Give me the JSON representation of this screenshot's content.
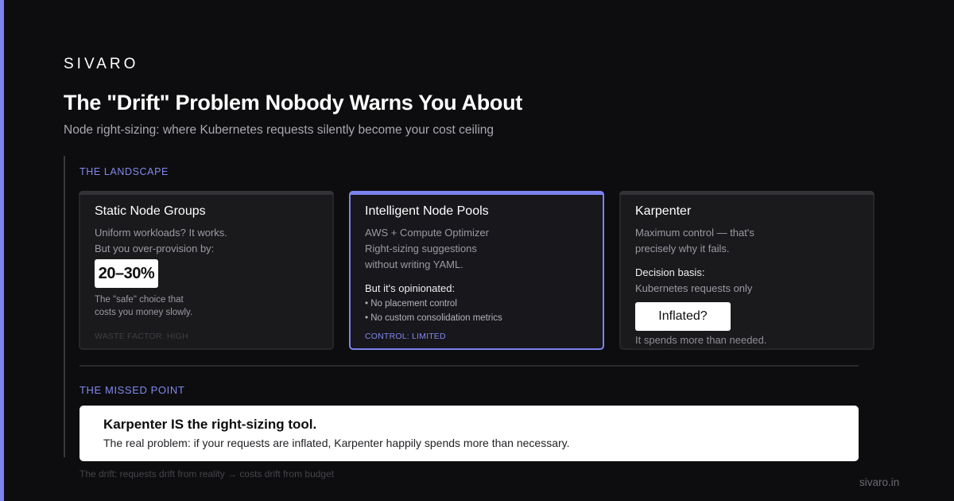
{
  "colors": {
    "background": "#0d0d0f",
    "accent": "#7c83ee",
    "card": "#1a1a1d",
    "white": "#ffffff"
  },
  "brand": "SIVARO",
  "title": "The \"Drift\" Problem Nobody Warns You About",
  "subtitle": "Node right-sizing: where Kubernetes requests silently become your cost ceiling",
  "landscape": {
    "label": "THE LANDSCAPE",
    "cards": [
      {
        "title": "Static Node Groups",
        "lines": [
          "Uniform workloads? It works.",
          "But you over-provision by:"
        ],
        "badge": "20–30%",
        "note": [
          "The \"safe\" choice that",
          "costs you money slowly."
        ],
        "footer": "WASTE FACTOR: HIGH"
      },
      {
        "title": "Intelligent Node Pools",
        "lines": [
          "AWS + Compute Optimizer",
          "Right-sizing suggestions",
          "without writing YAML."
        ],
        "subheading": "But it's opinionated:",
        "bullets": [
          "• No placement control",
          "• No custom consolidation metrics"
        ],
        "footer": "CONTROL: LIMITED"
      },
      {
        "title": "Karpenter",
        "lines": [
          "Maximum control — that's",
          "precisely why it fails."
        ],
        "subheading": "Decision basis:",
        "basis": "Kubernetes requests only",
        "button": "Inflated?",
        "note": "It spends more than needed."
      }
    ]
  },
  "missed": {
    "label": "THE MISSED POINT",
    "title": "Karpenter IS the right-sizing tool.",
    "body": "The real problem: if your requests are inflated, Karpenter happily spends more than necessary."
  },
  "drift_note": "The drift: requests drift from reality → costs drift from budget",
  "site": "sivaro.in"
}
